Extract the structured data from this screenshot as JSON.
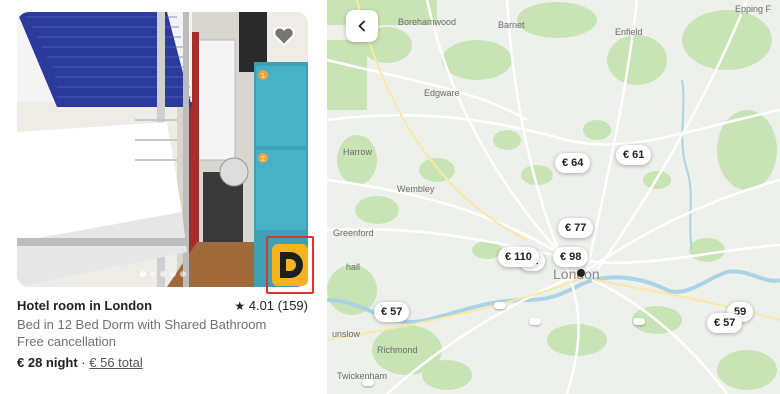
{
  "listing": {
    "title": "Hotel room in London",
    "rating_star": "★",
    "rating": "4.01 (159)",
    "subtitle": "Bed in 12 Bed Dorm with Shared Bathroom",
    "cancellation": "Free cancellation",
    "price_night": "€ 28 night",
    "price_sep": " · ",
    "price_total": "€ 56 total",
    "photo_count": 5,
    "photo_active": 1,
    "locker_numbers": [
      "1",
      "2"
    ]
  },
  "map": {
    "places": {
      "borehamwood": "Borehamwood",
      "barnet": "Barnet",
      "enfield": "Enfield",
      "epping": "Epping F",
      "edgware": "Edgware",
      "harrow": "Harrow",
      "wembley": "Wembley",
      "greenford": "Greenford",
      "hall": "hall",
      "london": "London",
      "hounslow": "unslow",
      "richmond": "Richmond",
      "twickenham": "Twickenham"
    },
    "pins": {
      "p64": "€ 64",
      "p61": "€ 61",
      "p77": "€ 77",
      "p110": "€ 110",
      "p31": "31",
      "p98": "€ 98",
      "p57a": "€ 57",
      "p59": "59",
      "p57b": "€ 57"
    }
  },
  "colors": {
    "map_bg": "#eef0ec",
    "park": "#c9e4b4",
    "water": "#aad3e6",
    "road": "#ffffff",
    "major_road": "#fbe8a6",
    "logo": "#f5b31e",
    "highlight": "#e0322f"
  }
}
